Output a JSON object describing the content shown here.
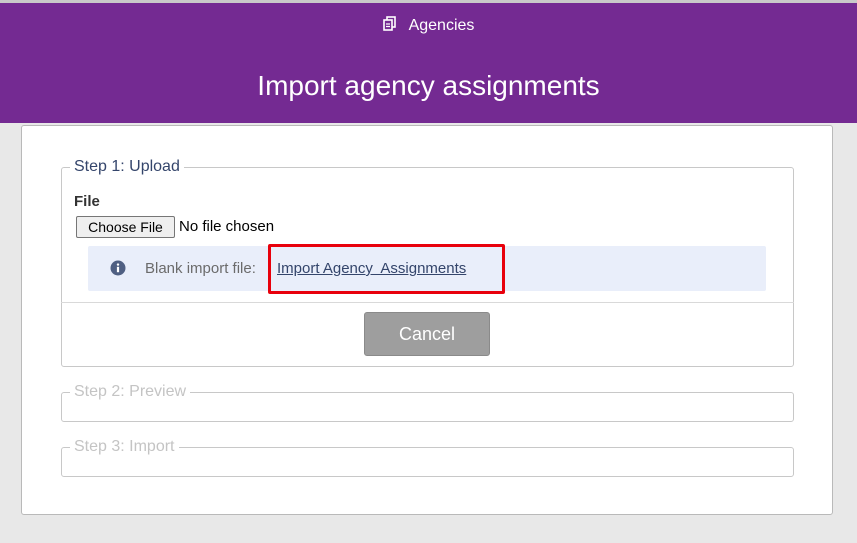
{
  "header": {
    "breadcrumb": "Agencies",
    "breadcrumb_icon": "copy-documents-icon",
    "title": "Import agency assignments",
    "background": "#742a92"
  },
  "steps": [
    {
      "legend": "Step 1: Upload"
    },
    {
      "legend": "Step 2: Preview"
    },
    {
      "legend": "Step 3: Import"
    }
  ],
  "upload": {
    "file_label": "File",
    "choose_button": "Choose File",
    "no_file_text": "No file chosen",
    "info_icon": "info-circle-icon",
    "blank_file_text": "Blank import file:",
    "template_link": "Import Agency  Assignments"
  },
  "actions": {
    "cancel_label": "Cancel"
  },
  "colors": {
    "highlight_border": "#e8000c",
    "info_background": "#e9eefa",
    "link": "#34456b"
  }
}
